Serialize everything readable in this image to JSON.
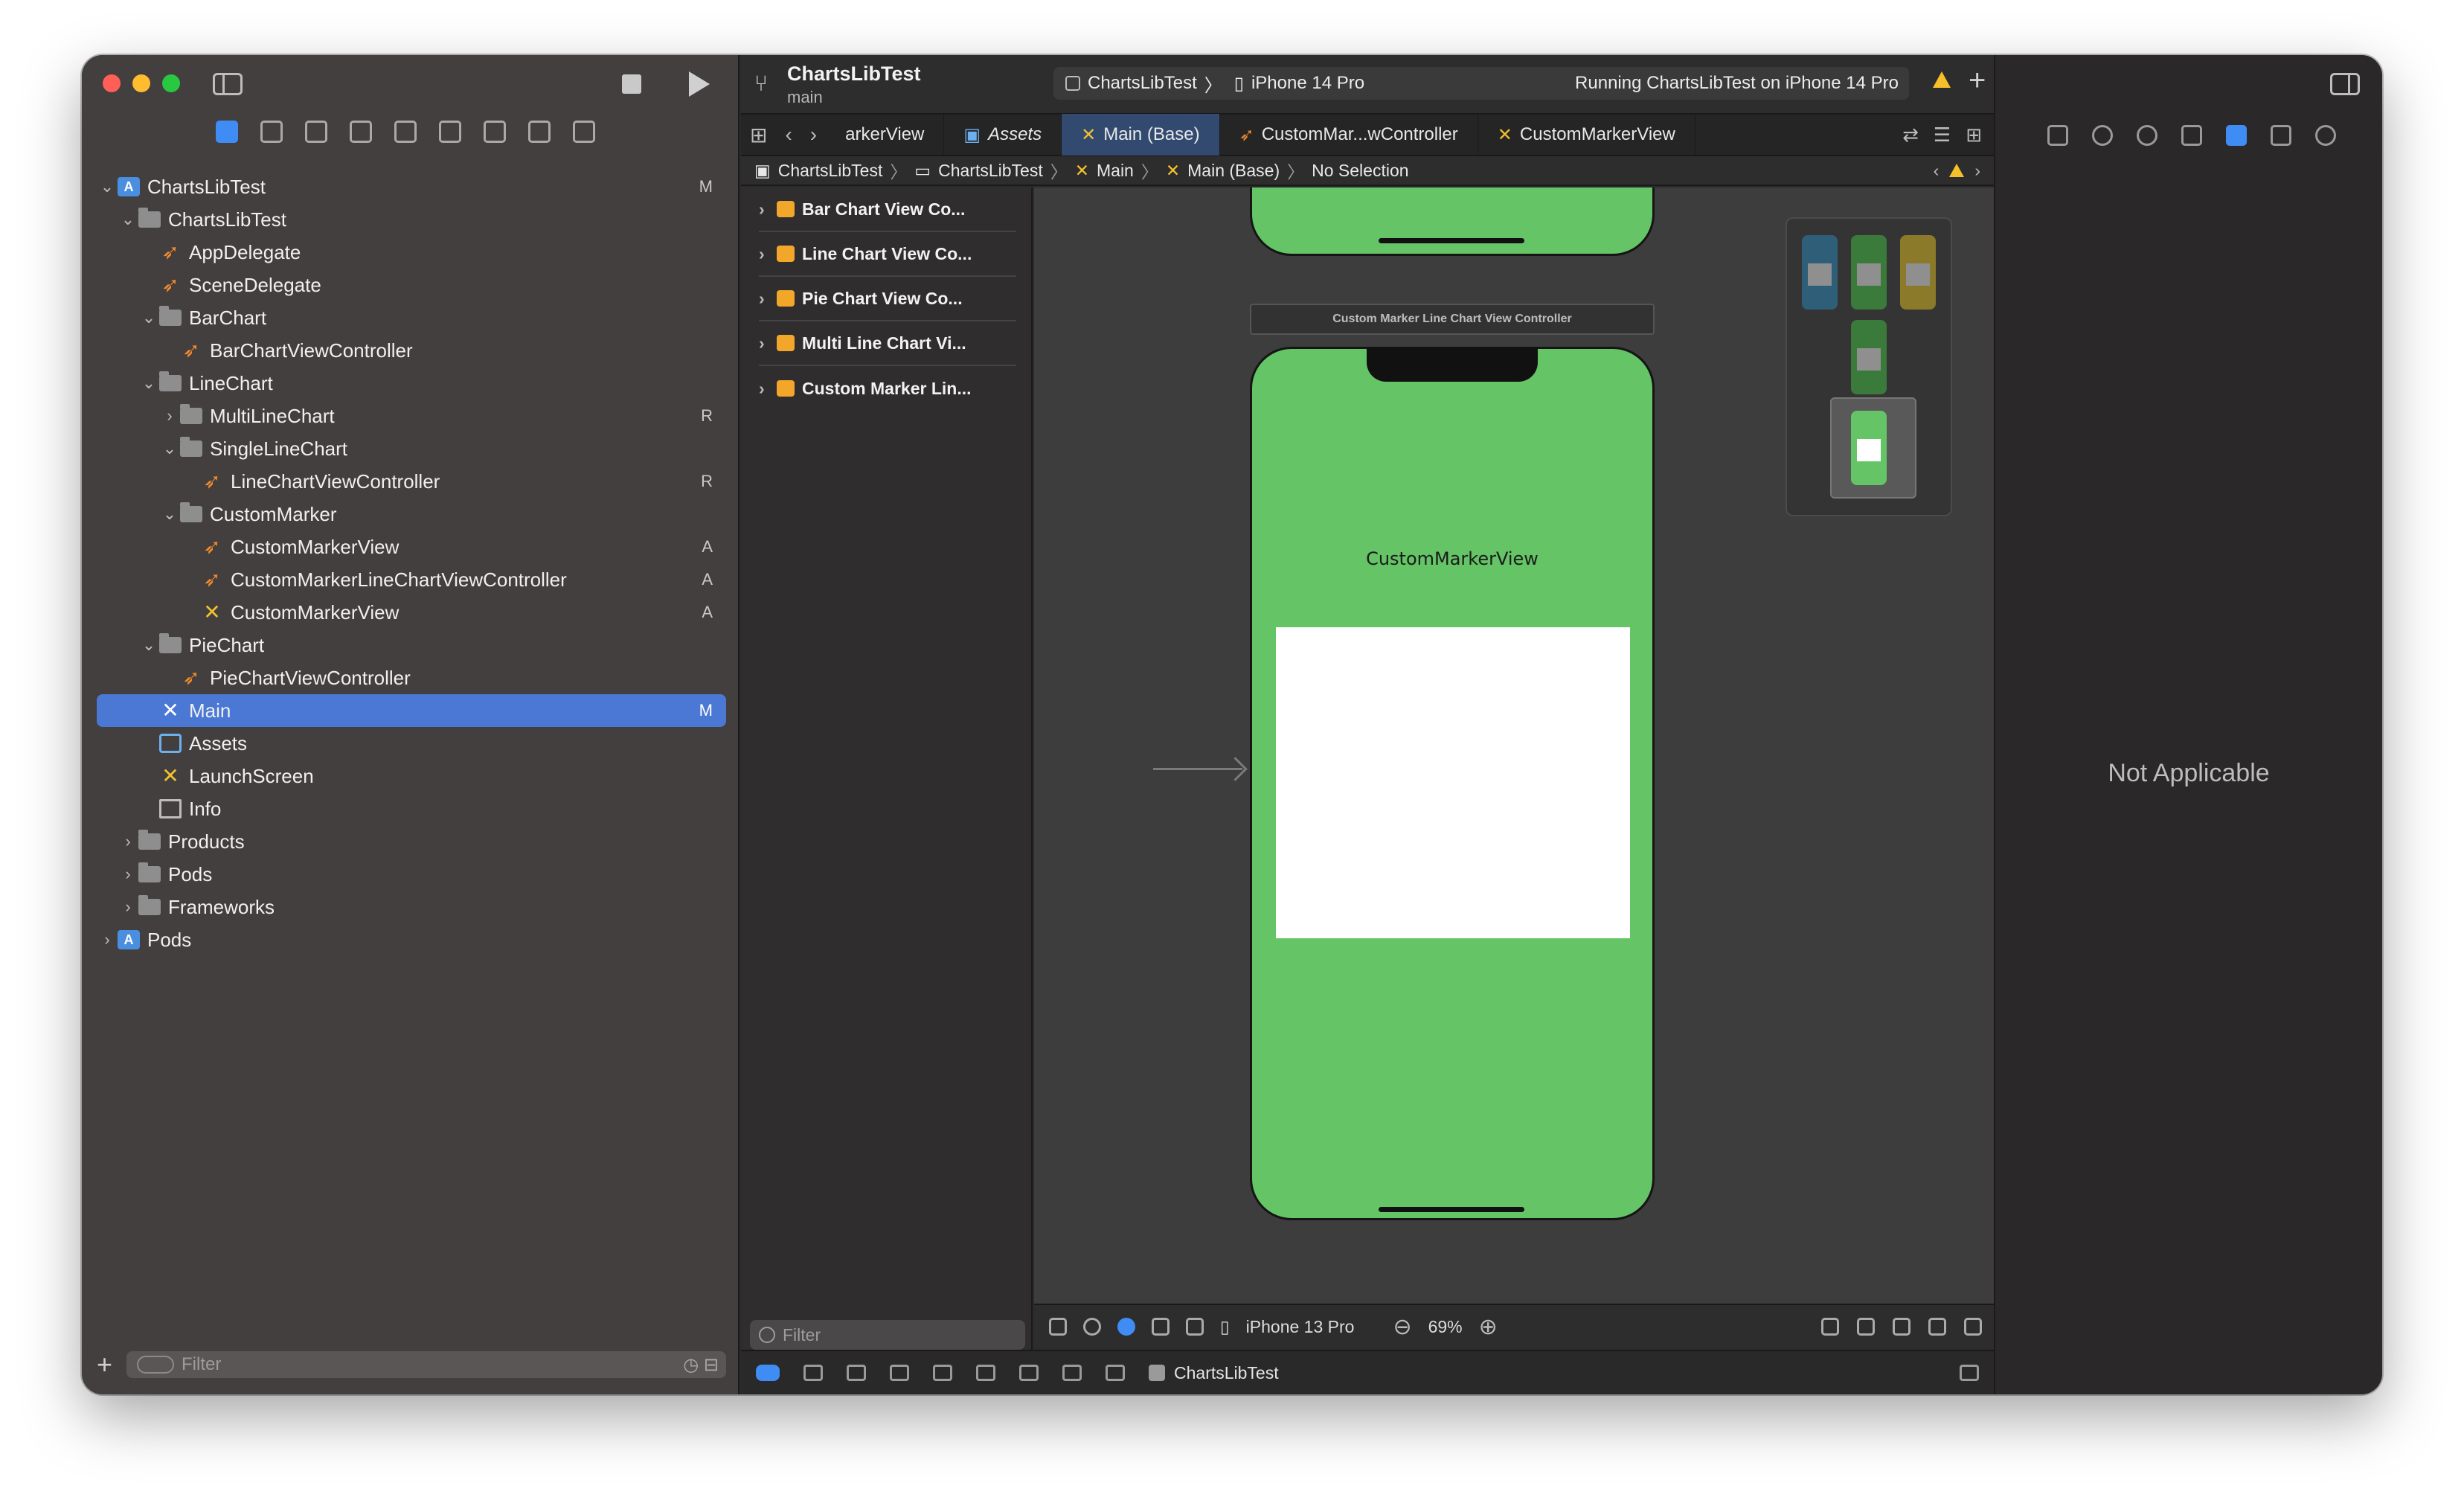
{
  "toolbar": {
    "project_title": "ChartsLibTest",
    "branch": "main",
    "scheme": "ChartsLibTest",
    "device": "iPhone 14 Pro",
    "status": "Running ChartsLibTest on iPhone 14 Pro",
    "add": "+"
  },
  "navigator": {
    "items": [
      {
        "label": "ChartsLibTest",
        "badge": "M"
      },
      {
        "label": "ChartsLibTest",
        "badge": ""
      },
      {
        "label": "AppDelegate",
        "badge": ""
      },
      {
        "label": "SceneDelegate",
        "badge": ""
      },
      {
        "label": "BarChart",
        "badge": ""
      },
      {
        "label": "BarChartViewController",
        "badge": ""
      },
      {
        "label": "LineChart",
        "badge": ""
      },
      {
        "label": "MultiLineChart",
        "badge": "R"
      },
      {
        "label": "SingleLineChart",
        "badge": ""
      },
      {
        "label": "LineChartViewController",
        "badge": "R"
      },
      {
        "label": "CustomMarker",
        "badge": ""
      },
      {
        "label": "CustomMarkerView",
        "badge": "A"
      },
      {
        "label": "CustomMarkerLineChartViewController",
        "badge": "A"
      },
      {
        "label": "CustomMarkerView",
        "badge": "A"
      },
      {
        "label": "PieChart",
        "badge": ""
      },
      {
        "label": "PieChartViewController",
        "badge": ""
      },
      {
        "label": "Main",
        "badge": "M"
      },
      {
        "label": "Assets",
        "badge": ""
      },
      {
        "label": "LaunchScreen",
        "badge": ""
      },
      {
        "label": "Info",
        "badge": ""
      },
      {
        "label": "Products",
        "badge": ""
      },
      {
        "label": "Pods",
        "badge": ""
      },
      {
        "label": "Frameworks",
        "badge": ""
      },
      {
        "label": "Pods",
        "badge": ""
      }
    ],
    "filter_placeholder": "Filter"
  },
  "tabs": [
    {
      "label": "arkerView"
    },
    {
      "label": "Assets"
    },
    {
      "label": "Main (Base)"
    },
    {
      "label": "CustomMar...wController"
    },
    {
      "label": "CustomMarkerView"
    }
  ],
  "jumpbar": {
    "items": [
      "ChartsLibTest",
      "ChartsLibTest",
      "Main",
      "Main (Base)",
      "No Selection"
    ]
  },
  "outline": {
    "items": [
      {
        "label": "Bar Chart View Co..."
      },
      {
        "label": "Line Chart View Co..."
      },
      {
        "label": "Pie Chart View Co..."
      },
      {
        "label": "Multi Line Chart Vi..."
      },
      {
        "label": "Custom Marker Lin..."
      }
    ],
    "filter_placeholder": "Filter"
  },
  "canvas": {
    "scene_label": "Custom Marker Line Chart View Controller",
    "view_title": "CustomMarkerView"
  },
  "editor_bottom": {
    "device": "iPhone 13 Pro",
    "zoom": "69%"
  },
  "debug": {
    "target": "ChartsLibTest"
  },
  "inspector": {
    "message": "Not Applicable"
  },
  "colors": {
    "accent": "#3f8cf5",
    "selection": "#4a78d4",
    "phone_bg": "#64c466",
    "swift_icon": "#f28a2d",
    "xib_icon": "#f2c12e",
    "warning": "#f5c02a"
  }
}
